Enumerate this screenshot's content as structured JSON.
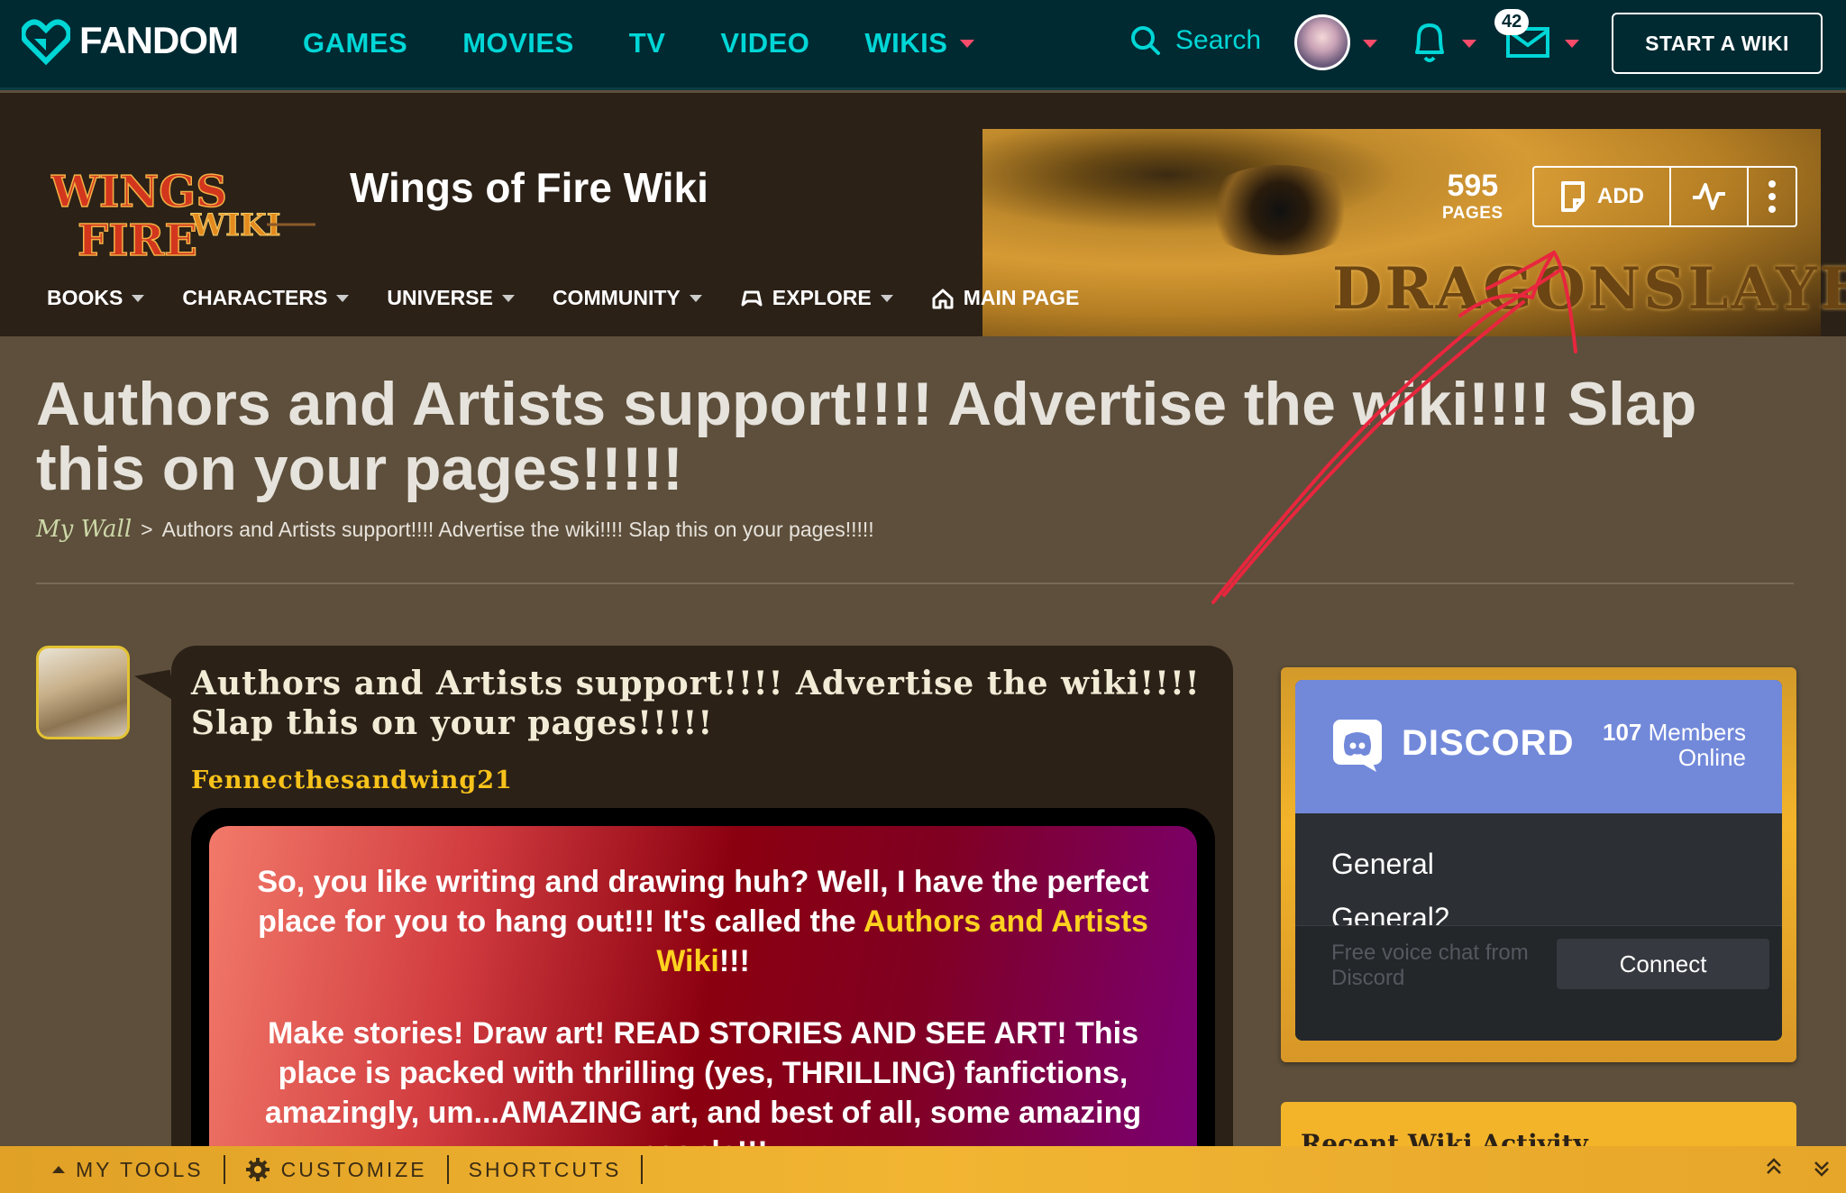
{
  "global_nav": {
    "brand": "FANDOM",
    "links": [
      "GAMES",
      "MOVIES",
      "TV",
      "VIDEO",
      "WIKIS"
    ],
    "search_label": "Search",
    "notifications_count": "42",
    "start_wiki": "START A WIKI",
    "accent_color": "#00d6d6",
    "caret_color": "#f94b6a"
  },
  "community": {
    "logo_text_1": "WINGS",
    "logo_text_2": "FIRE",
    "logo_text_3": "WIKI",
    "name": "Wings of Fire Wiki",
    "pages_count": "595",
    "pages_label": "PAGES",
    "add_label": "ADD",
    "banner_text": "DRAGONSLAYER",
    "nav": [
      "BOOKS",
      "CHARACTERS",
      "UNIVERSE",
      "COMMUNITY",
      "EXPLORE",
      "MAIN PAGE"
    ]
  },
  "page": {
    "title": "Authors and Artists support!!!! Advertise the wiki!!!! Slap this on your pages!!!!!",
    "breadcrumb_root": "My Wall",
    "breadcrumb_sep": ">",
    "breadcrumb_current": "Authors and Artists support!!!! Advertise the wiki!!!! Slap this on your pages!!!!!"
  },
  "message": {
    "title": "Authors and Artists support!!!! Advertise the wiki!!!! Slap this on your pages!!!!!",
    "author": "Fennecthesandwing21",
    "para1_a": "So, you like writing and drawing huh? Well, I have the perfect place for you to hang out!!! It's called the",
    "para1_link": "Authors and Artists Wiki",
    "para1_b": "!!!",
    "para2": "Make stories! Draw art! READ STORIES AND SEE ART! This place is packed with thrilling (yes, THRILLING) fanfictions, amazingly, um...AMAZING art, and best of all,",
    "para2_cut": "some amazing people!!!"
  },
  "discord": {
    "brand": "DISCORD",
    "members_count": "107",
    "members_label": "Members",
    "online_label": "Online",
    "channels": [
      "General",
      "General2"
    ],
    "footer_text": "Free voice chat from Discord",
    "connect_label": "Connect",
    "header_color": "#7289da"
  },
  "recent_activity": {
    "label": "Recent Wiki Activity"
  },
  "toolbar": {
    "my_tools": "MY TOOLS",
    "customize": "CUSTOMIZE",
    "shortcuts": "SHORTCUTS"
  }
}
